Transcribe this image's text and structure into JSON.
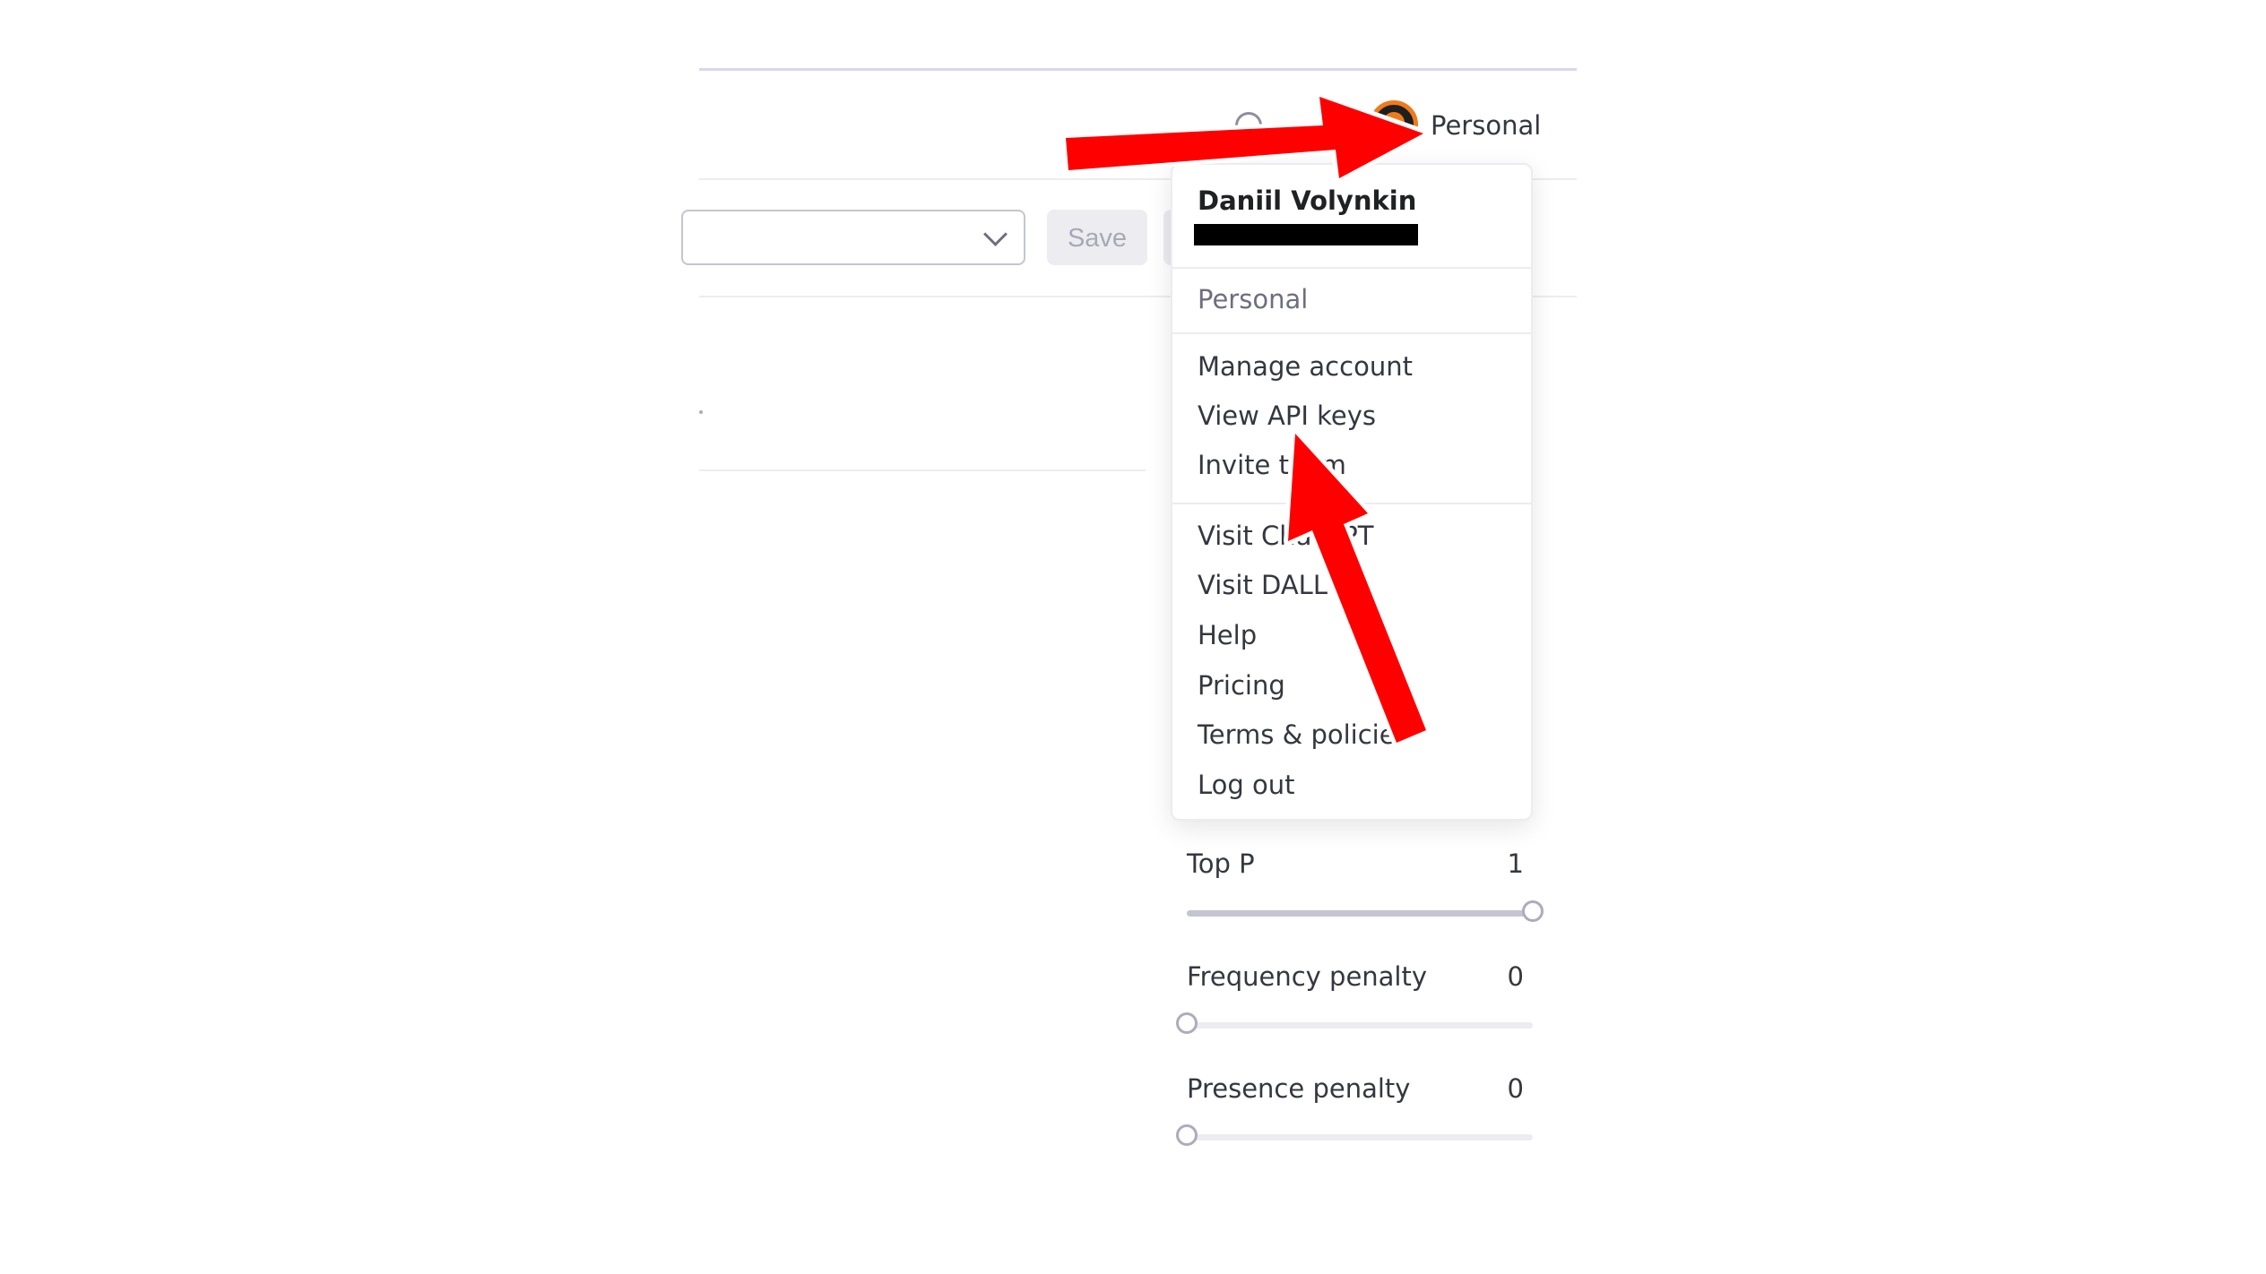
{
  "header": {
    "org_label": "Personal"
  },
  "toolbar": {
    "save_label": "Save"
  },
  "account_menu": {
    "user_name": "Daniil Volynkin",
    "org_label": "Personal",
    "account_items": [
      {
        "label": "Manage account"
      },
      {
        "label": "View API keys"
      },
      {
        "label": "Invite team"
      }
    ],
    "link_items": [
      {
        "label": "Visit ChatGPT"
      },
      {
        "label": "Visit DALL·E"
      },
      {
        "label": "Help"
      },
      {
        "label": "Pricing"
      },
      {
        "label": "Terms & policies"
      },
      {
        "label": "Log out"
      }
    ]
  },
  "parameters": [
    {
      "label": "Top P",
      "value": "1",
      "level": 1.0
    },
    {
      "label": "Frequency penalty",
      "value": "0",
      "level": 0.0
    },
    {
      "label": "Presence penalty",
      "value": "0",
      "level": 0.0
    }
  ],
  "colors": {
    "annotation_arrow": "#ff0000",
    "avatar_ring": "#f07a1a",
    "top_accent": "#d9d6ef"
  },
  "icons": {
    "help": "help-circle-icon",
    "avatar": "user-avatar",
    "select": "chevron-down-icon"
  }
}
